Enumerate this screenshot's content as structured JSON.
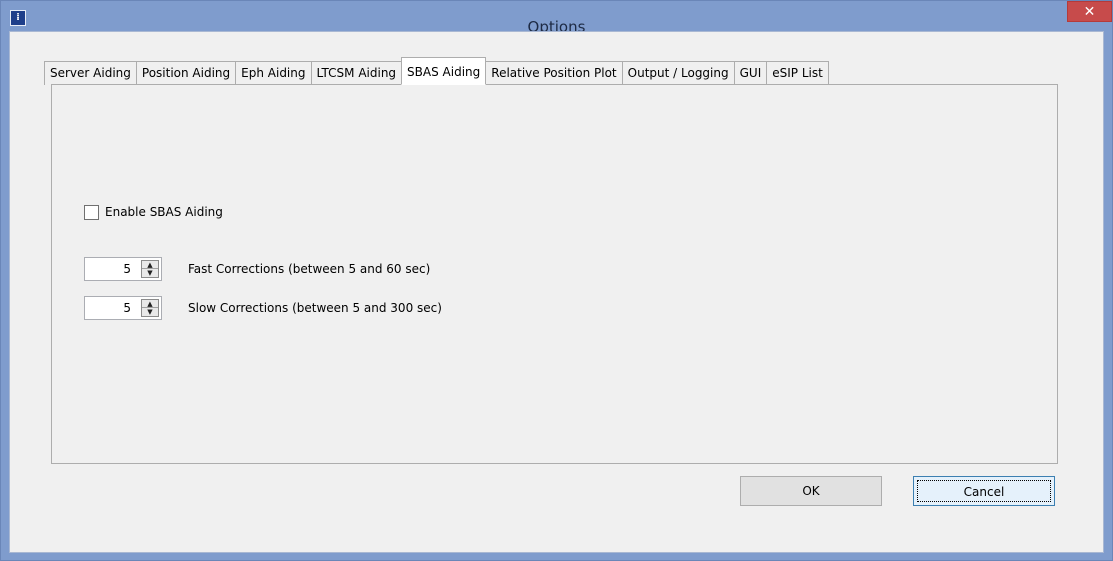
{
  "window": {
    "title": "Options",
    "close_label": "✕",
    "app_icon_label": "⁞"
  },
  "tabs": [
    {
      "label": "Server Aiding",
      "active": false
    },
    {
      "label": "Position Aiding",
      "active": false
    },
    {
      "label": "Eph Aiding",
      "active": false
    },
    {
      "label": "LTCSM Aiding",
      "active": false
    },
    {
      "label": "SBAS Aiding",
      "active": true
    },
    {
      "label": "Relative Position Plot",
      "active": false
    },
    {
      "label": "Output / Logging",
      "active": false
    },
    {
      "label": "GUI",
      "active": false
    },
    {
      "label": "eSIP List",
      "active": false
    }
  ],
  "sbas": {
    "enable_label": "Enable SBAS Aiding",
    "enable_checked": false,
    "fast": {
      "value": "5",
      "label": "Fast Corrections (between 5 and 60 sec)"
    },
    "slow": {
      "value": "5",
      "label": "Slow Corrections (between 5 and 300 sec)"
    }
  },
  "buttons": {
    "ok": "OK",
    "cancel": "Cancel"
  },
  "icons": {
    "up_arrow": "▲",
    "down_arrow": "▼"
  }
}
